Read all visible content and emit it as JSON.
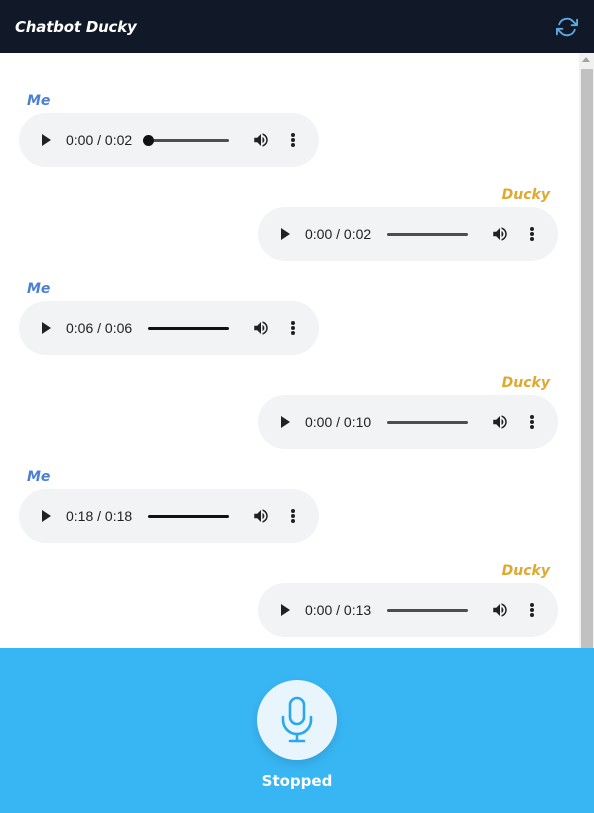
{
  "header": {
    "title": "Chatbot Ducky",
    "refresh_icon": "refresh-icon"
  },
  "messages": [
    {
      "sender": "Me",
      "role": "user",
      "time": "0:00 / 0:02",
      "progress": 0.0
    },
    {
      "sender": "Ducky",
      "role": "bot",
      "time": "0:00 / 0:02",
      "progress": 0.0
    },
    {
      "sender": "Me",
      "role": "user",
      "time": "0:06 / 0:06",
      "progress": 1.0
    },
    {
      "sender": "Ducky",
      "role": "bot",
      "time": "0:00 / 0:10",
      "progress": 0.0
    },
    {
      "sender": "Me",
      "role": "user",
      "time": "0:18 / 0:18",
      "progress": 1.0
    },
    {
      "sender": "Ducky",
      "role": "bot",
      "time": "0:00 / 0:13",
      "progress": 0.0
    }
  ],
  "footer": {
    "mic_icon": "microphone-icon",
    "status": "Stopped"
  },
  "colors": {
    "header_bg": "#111827",
    "me_label": "#4a7fd4",
    "ducky_label": "#e0a82e",
    "footer_bg": "#38b6f4",
    "player_bg": "#f1f3f4"
  }
}
